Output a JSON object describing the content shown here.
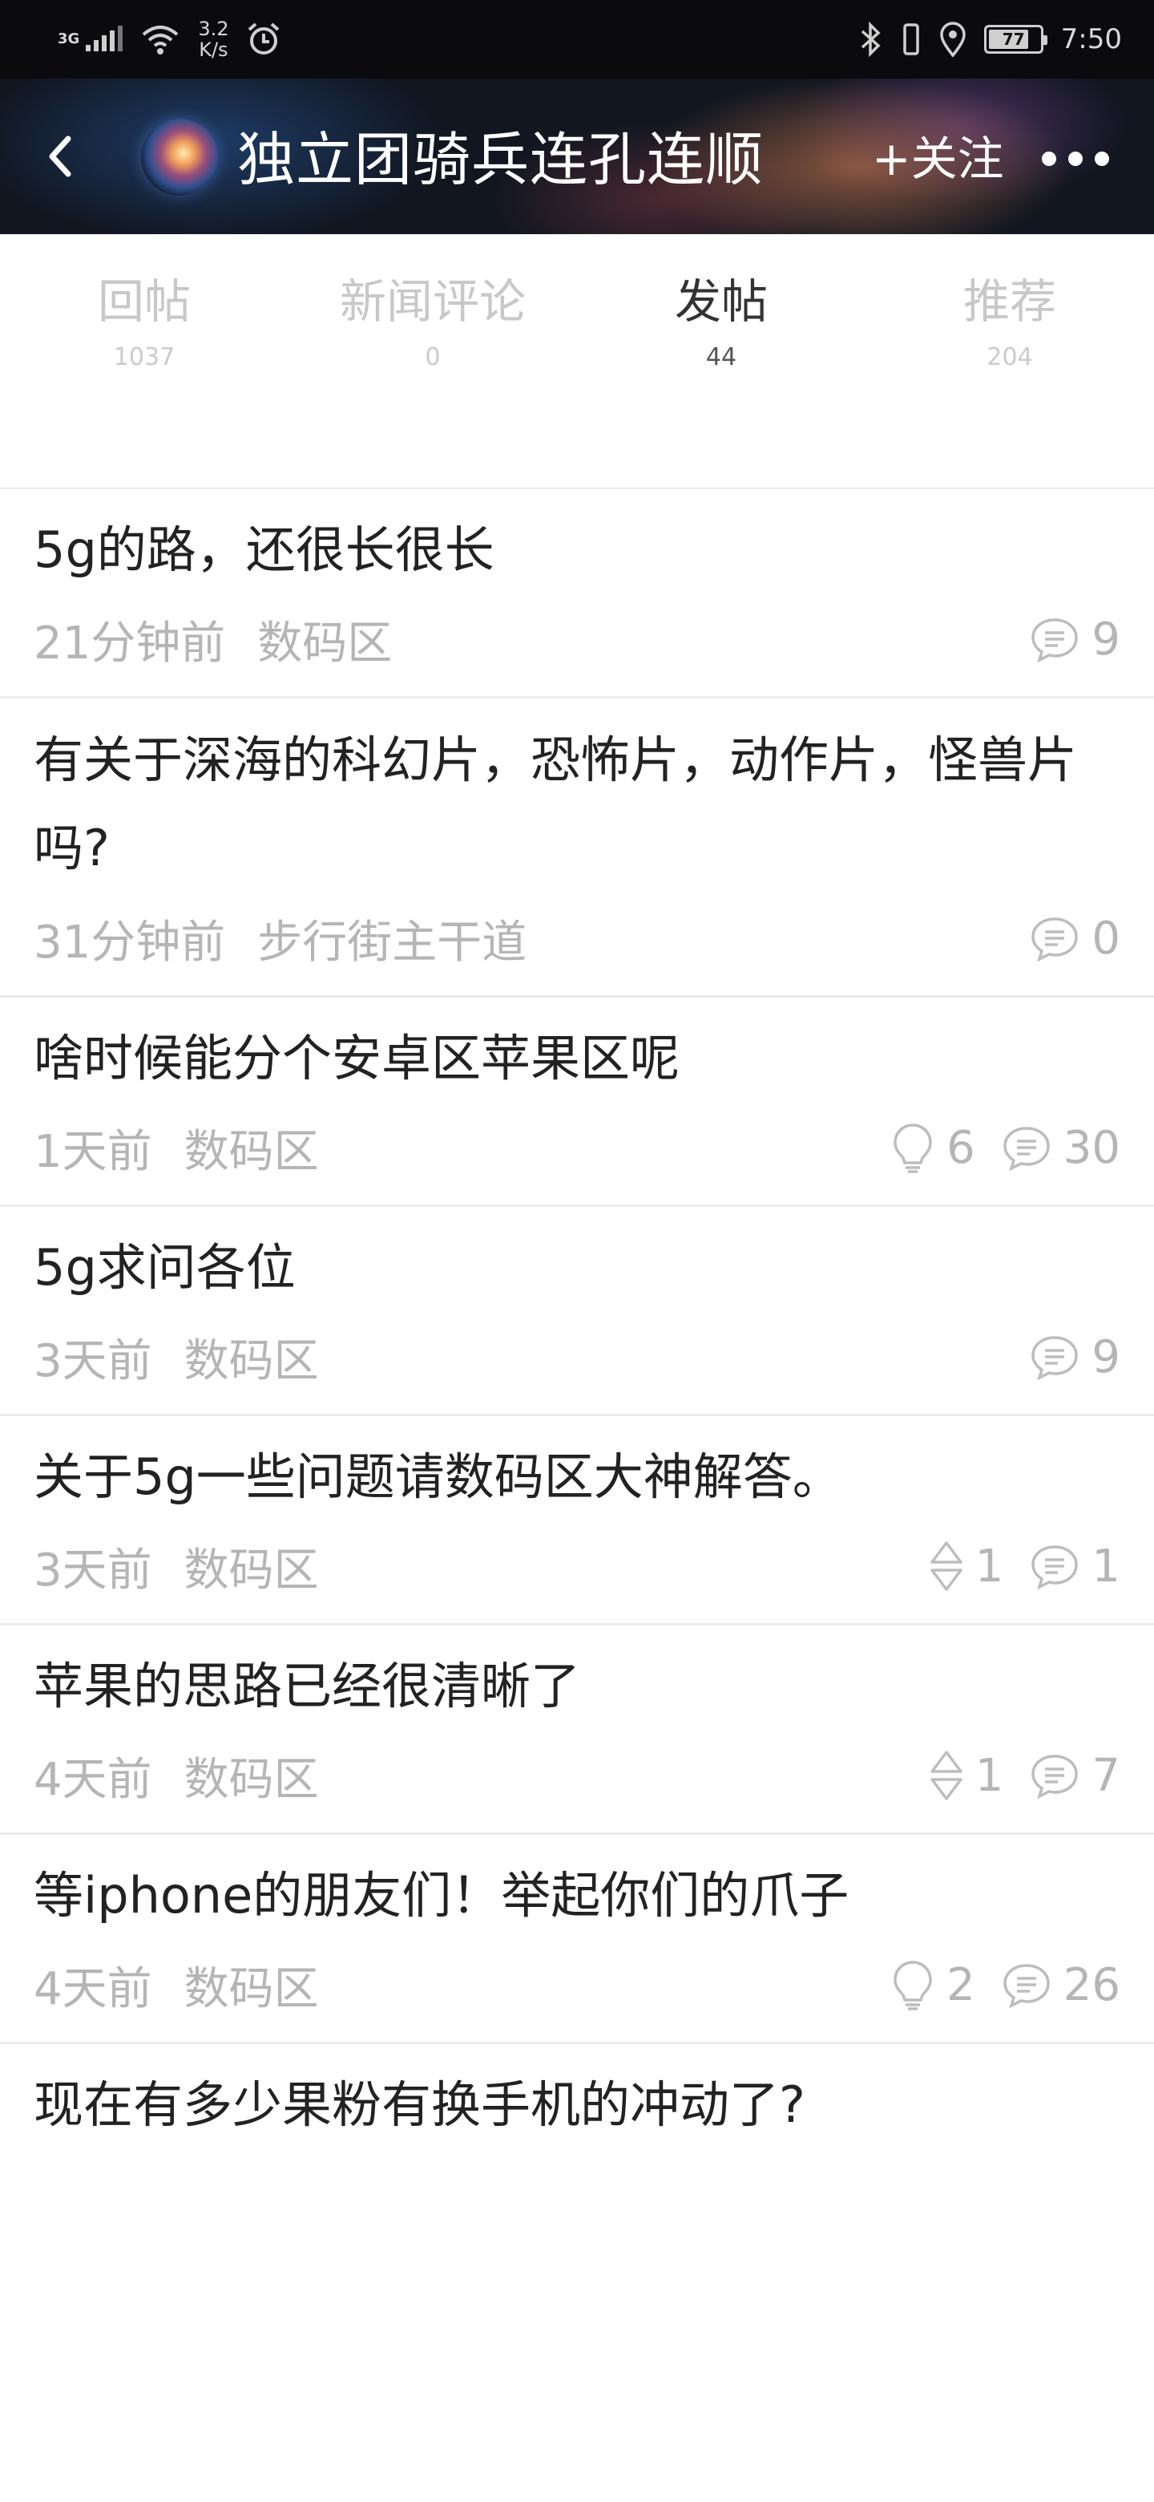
{
  "status_bar": {
    "network": "3G",
    "speed": "3.2",
    "speed_unit": "K/s",
    "battery": "77",
    "time": "7:50"
  },
  "header": {
    "title": "独立团骑兵连孔连顺",
    "follow_label": "+关注"
  },
  "tabs": [
    {
      "label": "回帖",
      "count": "1037",
      "active": false
    },
    {
      "label": "新闻评论",
      "count": "0",
      "active": false
    },
    {
      "label": "发帖",
      "count": "44",
      "active": true
    },
    {
      "label": "推荐",
      "count": "204",
      "active": false
    }
  ],
  "posts": [
    {
      "title": "5g的路，还很长很长",
      "time": "21分钟前",
      "board": "数码区",
      "comments": "9"
    },
    {
      "title": "有关于深海的科幻片，恐怖片，动作片，怪兽片吗?",
      "time": "31分钟前",
      "board": "步行街主干道",
      "comments": "0"
    },
    {
      "title": "啥时候能分个安卓区苹果区呢",
      "time": "1天前",
      "board": "数码区",
      "lights": "6",
      "comments": "30"
    },
    {
      "title": "5g求问各位",
      "time": "3天前",
      "board": "数码区",
      "comments": "9"
    },
    {
      "title": "关于5g一些问题请数码区大神解答。",
      "time": "3天前",
      "board": "数码区",
      "votes": "1",
      "comments": "1"
    },
    {
      "title": "苹果的思路已经很清晰了",
      "time": "4天前",
      "board": "数码区",
      "votes": "1",
      "comments": "7"
    },
    {
      "title": "等iphone的朋友们！举起你们的爪子",
      "time": "4天前",
      "board": "数码区",
      "lights": "2",
      "comments": "26"
    },
    {
      "title": "现在有多少果粉有换手机的冲动了?"
    }
  ],
  "colors": {
    "status_bar_bg": "#0b0b0d",
    "active_tab": "#333333",
    "inactive_tab": "#c8c8c8",
    "meta_text": "#b5b5b5",
    "divider": "#ececec"
  }
}
